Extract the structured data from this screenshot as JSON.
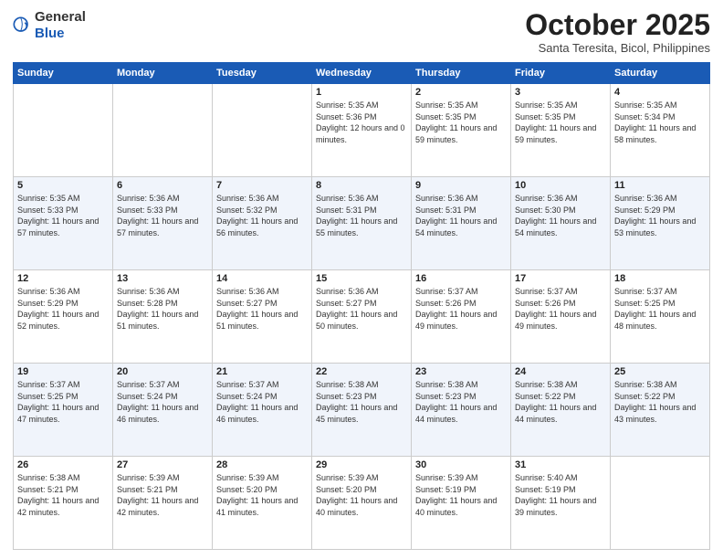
{
  "logo": {
    "text_general": "General",
    "text_blue": "Blue"
  },
  "header": {
    "month_year": "October 2025",
    "location": "Santa Teresita, Bicol, Philippines"
  },
  "weekdays": [
    "Sunday",
    "Monday",
    "Tuesday",
    "Wednesday",
    "Thursday",
    "Friday",
    "Saturday"
  ],
  "weeks": [
    [
      {
        "day": "",
        "info": ""
      },
      {
        "day": "",
        "info": ""
      },
      {
        "day": "",
        "info": ""
      },
      {
        "day": "1",
        "info": "Sunrise: 5:35 AM\nSunset: 5:36 PM\nDaylight: 12 hours\nand 0 minutes."
      },
      {
        "day": "2",
        "info": "Sunrise: 5:35 AM\nSunset: 5:35 PM\nDaylight: 11 hours\nand 59 minutes."
      },
      {
        "day": "3",
        "info": "Sunrise: 5:35 AM\nSunset: 5:35 PM\nDaylight: 11 hours\nand 59 minutes."
      },
      {
        "day": "4",
        "info": "Sunrise: 5:35 AM\nSunset: 5:34 PM\nDaylight: 11 hours\nand 58 minutes."
      }
    ],
    [
      {
        "day": "5",
        "info": "Sunrise: 5:35 AM\nSunset: 5:33 PM\nDaylight: 11 hours\nand 57 minutes."
      },
      {
        "day": "6",
        "info": "Sunrise: 5:36 AM\nSunset: 5:33 PM\nDaylight: 11 hours\nand 57 minutes."
      },
      {
        "day": "7",
        "info": "Sunrise: 5:36 AM\nSunset: 5:32 PM\nDaylight: 11 hours\nand 56 minutes."
      },
      {
        "day": "8",
        "info": "Sunrise: 5:36 AM\nSunset: 5:31 PM\nDaylight: 11 hours\nand 55 minutes."
      },
      {
        "day": "9",
        "info": "Sunrise: 5:36 AM\nSunset: 5:31 PM\nDaylight: 11 hours\nand 54 minutes."
      },
      {
        "day": "10",
        "info": "Sunrise: 5:36 AM\nSunset: 5:30 PM\nDaylight: 11 hours\nand 54 minutes."
      },
      {
        "day": "11",
        "info": "Sunrise: 5:36 AM\nSunset: 5:29 PM\nDaylight: 11 hours\nand 53 minutes."
      }
    ],
    [
      {
        "day": "12",
        "info": "Sunrise: 5:36 AM\nSunset: 5:29 PM\nDaylight: 11 hours\nand 52 minutes."
      },
      {
        "day": "13",
        "info": "Sunrise: 5:36 AM\nSunset: 5:28 PM\nDaylight: 11 hours\nand 51 minutes."
      },
      {
        "day": "14",
        "info": "Sunrise: 5:36 AM\nSunset: 5:27 PM\nDaylight: 11 hours\nand 51 minutes."
      },
      {
        "day": "15",
        "info": "Sunrise: 5:36 AM\nSunset: 5:27 PM\nDaylight: 11 hours\nand 50 minutes."
      },
      {
        "day": "16",
        "info": "Sunrise: 5:37 AM\nSunset: 5:26 PM\nDaylight: 11 hours\nand 49 minutes."
      },
      {
        "day": "17",
        "info": "Sunrise: 5:37 AM\nSunset: 5:26 PM\nDaylight: 11 hours\nand 49 minutes."
      },
      {
        "day": "18",
        "info": "Sunrise: 5:37 AM\nSunset: 5:25 PM\nDaylight: 11 hours\nand 48 minutes."
      }
    ],
    [
      {
        "day": "19",
        "info": "Sunrise: 5:37 AM\nSunset: 5:25 PM\nDaylight: 11 hours\nand 47 minutes."
      },
      {
        "day": "20",
        "info": "Sunrise: 5:37 AM\nSunset: 5:24 PM\nDaylight: 11 hours\nand 46 minutes."
      },
      {
        "day": "21",
        "info": "Sunrise: 5:37 AM\nSunset: 5:24 PM\nDaylight: 11 hours\nand 46 minutes."
      },
      {
        "day": "22",
        "info": "Sunrise: 5:38 AM\nSunset: 5:23 PM\nDaylight: 11 hours\nand 45 minutes."
      },
      {
        "day": "23",
        "info": "Sunrise: 5:38 AM\nSunset: 5:23 PM\nDaylight: 11 hours\nand 44 minutes."
      },
      {
        "day": "24",
        "info": "Sunrise: 5:38 AM\nSunset: 5:22 PM\nDaylight: 11 hours\nand 44 minutes."
      },
      {
        "day": "25",
        "info": "Sunrise: 5:38 AM\nSunset: 5:22 PM\nDaylight: 11 hours\nand 43 minutes."
      }
    ],
    [
      {
        "day": "26",
        "info": "Sunrise: 5:38 AM\nSunset: 5:21 PM\nDaylight: 11 hours\nand 42 minutes."
      },
      {
        "day": "27",
        "info": "Sunrise: 5:39 AM\nSunset: 5:21 PM\nDaylight: 11 hours\nand 42 minutes."
      },
      {
        "day": "28",
        "info": "Sunrise: 5:39 AM\nSunset: 5:20 PM\nDaylight: 11 hours\nand 41 minutes."
      },
      {
        "day": "29",
        "info": "Sunrise: 5:39 AM\nSunset: 5:20 PM\nDaylight: 11 hours\nand 40 minutes."
      },
      {
        "day": "30",
        "info": "Sunrise: 5:39 AM\nSunset: 5:19 PM\nDaylight: 11 hours\nand 40 minutes."
      },
      {
        "day": "31",
        "info": "Sunrise: 5:40 AM\nSunset: 5:19 PM\nDaylight: 11 hours\nand 39 minutes."
      },
      {
        "day": "",
        "info": ""
      }
    ]
  ]
}
